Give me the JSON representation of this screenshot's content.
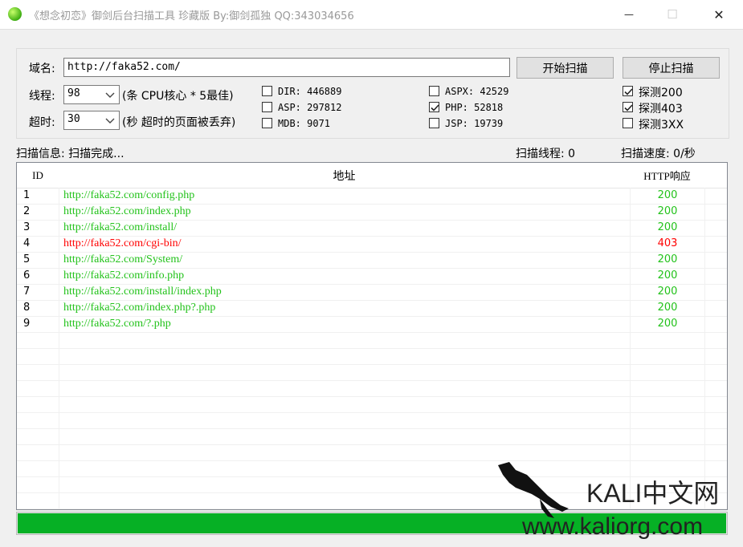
{
  "window": {
    "title": "《想念初恋》御剑后台扫描工具 珍藏版 By:御剑孤独 QQ:343034656",
    "icon": "green-ball-icon",
    "minimize_glyph": "—",
    "maximize_glyph": "☐",
    "close_glyph": "✕"
  },
  "form": {
    "domain_label": "域名:",
    "domain_value": "http://faka52.com/",
    "threads_label": "线程:",
    "threads_value": "98",
    "threads_hint": "(条 CPU核心 * 5最佳)",
    "timeout_label": "超时:",
    "timeout_value": "30",
    "timeout_hint": "(秒 超时的页面被丢弃)",
    "start_button": "开始扫描",
    "stop_button": "停止扫描"
  },
  "dictionaries": [
    {
      "label": "DIR: 446889",
      "checked": false
    },
    {
      "label": "ASP: 297812",
      "checked": false
    },
    {
      "label": "MDB: 9071",
      "checked": false
    },
    {
      "label": "ASPX: 42529",
      "checked": false
    },
    {
      "label": "PHP: 52818",
      "checked": true
    },
    {
      "label": "JSP: 19739",
      "checked": false
    }
  ],
  "probes": [
    {
      "label": "探测200",
      "checked": true
    },
    {
      "label": "探测403",
      "checked": true
    },
    {
      "label": "探测3XX",
      "checked": false
    }
  ],
  "status": {
    "info": "扫描信息: 扫描完成...",
    "threads": "扫描线程: 0",
    "speed": "扫描速度: 0/秒"
  },
  "table": {
    "headers": {
      "id": "ID",
      "url": "地址",
      "code": "HTTP响应"
    },
    "rows": [
      {
        "id": "1",
        "url": "http://faka52.com/config.php",
        "code": "200",
        "color": "#22c21a"
      },
      {
        "id": "2",
        "url": "http://faka52.com/index.php",
        "code": "200",
        "color": "#22c21a"
      },
      {
        "id": "3",
        "url": "http://faka52.com/install/",
        "code": "200",
        "color": "#22c21a"
      },
      {
        "id": "4",
        "url": "http://faka52.com/cgi-bin/",
        "code": "403",
        "color": "#ff0000"
      },
      {
        "id": "5",
        "url": "http://faka52.com/System/",
        "code": "200",
        "color": "#22c21a"
      },
      {
        "id": "6",
        "url": "http://faka52.com/info.php",
        "code": "200",
        "color": "#22c21a"
      },
      {
        "id": "7",
        "url": "http://faka52.com/install/index.php",
        "code": "200",
        "color": "#22c21a"
      },
      {
        "id": "8",
        "url": "http://faka52.com/index.php?.php",
        "code": "200",
        "color": "#22c21a"
      },
      {
        "id": "9",
        "url": "http://faka52.com/?.php",
        "code": "200",
        "color": "#22c21a"
      }
    ]
  },
  "progress": {
    "percent": 100,
    "color": "#06b025"
  },
  "watermark": {
    "brand": "KALI中文网",
    "url": "www.kaliorg.com"
  }
}
